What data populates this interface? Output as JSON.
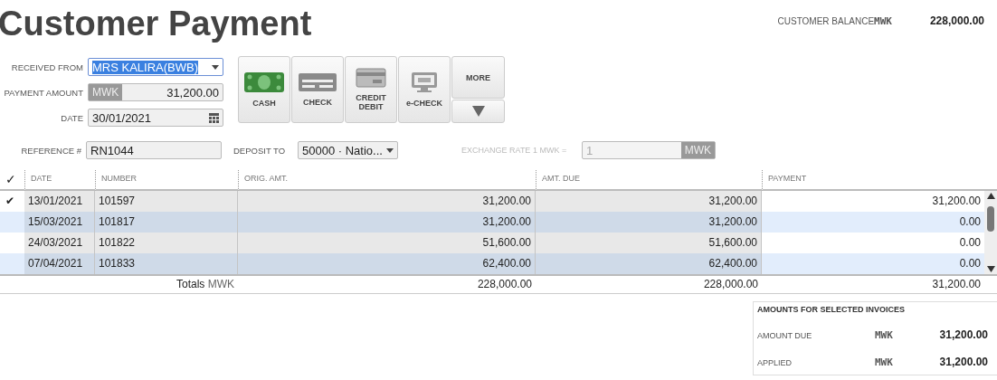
{
  "title": "Customer Payment",
  "customer_balance": {
    "label": "CUSTOMER BALANCE",
    "currency": "MWK",
    "amount": "228,000.00"
  },
  "form": {
    "received_from": {
      "label": "RECEIVED FROM",
      "value": "MRS KALIRA(BWB)"
    },
    "payment_amount": {
      "label": "PAYMENT AMOUNT",
      "currency": "MWK",
      "value": "31,200.00"
    },
    "date": {
      "label": "DATE",
      "value": "30/01/2021"
    },
    "reference": {
      "label": "REFERENCE #",
      "value": "RN1044"
    }
  },
  "payment_methods": [
    {
      "kind": "cash",
      "label": "CASH",
      "selected": false
    },
    {
      "kind": "check",
      "label": "CHECK",
      "selected": false
    },
    {
      "kind": "card",
      "label": "CREDIT\nDEBIT",
      "selected": false
    },
    {
      "kind": "echeck",
      "label": "e-CHECK",
      "selected": false
    }
  ],
  "more_button": {
    "label": "MORE"
  },
  "deposit_to": {
    "label": "DEPOSIT TO",
    "value": "50000 · Natio..."
  },
  "exchange_rate": {
    "label": "EXCHANGE RATE 1 MWK =",
    "value": "1",
    "currency": "MWK",
    "disabled": true
  },
  "table": {
    "check_header": "✓",
    "check_glyph": "✔",
    "columns": [
      "DATE",
      "NUMBER",
      "ORIG. AMT.",
      "AMT. DUE",
      "PAYMENT"
    ],
    "rows": [
      {
        "checked": true,
        "date": "13/01/2021",
        "number": "101597",
        "orig_amt": "31,200.00",
        "amt_due": "31,200.00",
        "payment": "31,200.00"
      },
      {
        "checked": false,
        "date": "15/03/2021",
        "number": "101817",
        "orig_amt": "31,200.00",
        "amt_due": "31,200.00",
        "payment": "0.00"
      },
      {
        "checked": false,
        "date": "24/03/2021",
        "number": "101822",
        "orig_amt": "51,600.00",
        "amt_due": "51,600.00",
        "payment": "0.00"
      },
      {
        "checked": false,
        "date": "07/04/2021",
        "number": "101833",
        "orig_amt": "62,400.00",
        "amt_due": "62,400.00",
        "payment": "0.00"
      }
    ],
    "totals": {
      "label": "Totals",
      "currency": "MWK",
      "orig_amt": "228,000.00",
      "amt_due": "228,000.00",
      "payment": "31,200.00"
    }
  },
  "selected_invoices": {
    "title": "AMOUNTS FOR SELECTED INVOICES",
    "rows": [
      {
        "label": "AMOUNT DUE",
        "currency": "MWK",
        "amount": "31,200.00"
      },
      {
        "label": "APPLIED",
        "currency": "MWK",
        "amount": "31,200.00"
      }
    ]
  }
}
